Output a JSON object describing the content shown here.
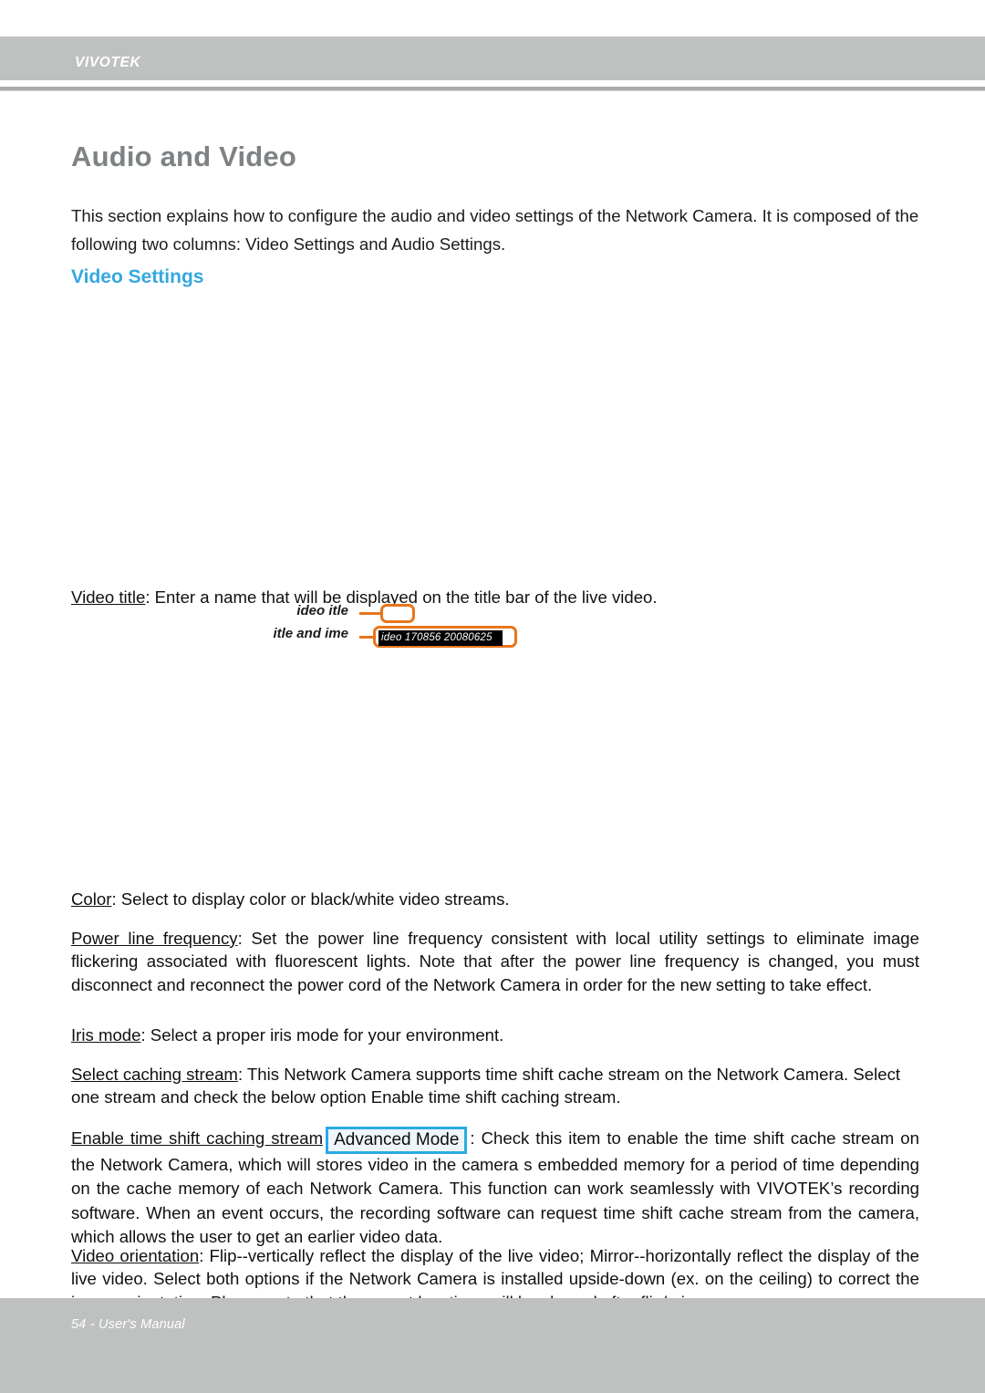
{
  "header": {
    "brand": "VIVOTEK"
  },
  "page": {
    "title": "Audio and Video",
    "intro": "This section explains how to configure the audio and video settings of the Network Camera. It is composed of the following two columns: Video Settings and Audio Settings.",
    "section_heading": "Video Settings"
  },
  "colors": {
    "header_band": "#bfc1c1",
    "heading_blue": "#35a8e0",
    "title_gray": "#7e8284",
    "callout_orange": "#e8751a",
    "badge_border": "#29abe2",
    "badge_fill": "#eef5fa"
  },
  "sections": {
    "video_title": {
      "term": "Video title",
      "body": ": Enter a name that will be displayed on the title bar of the live video."
    },
    "color": {
      "term": "Color",
      "body": ": Select to display color or black/white video streams."
    },
    "power_line_frequency": {
      "term": "Power line frequency",
      "body": ": Set the power line frequency consistent with local utility settings to eliminate image flickering associated with fluorescent lights. Note that after the power line frequency is changed, you must disconnect and reconnect the power cord of the Network Camera in order for the new setting to take effect."
    },
    "iris_mode": {
      "term": "Iris mode",
      "body": ": Select a proper iris mode for your environment."
    },
    "select_caching_stream": {
      "term": "Select caching stream",
      "body": ": This Network Camera supports time shift cache stream on the Network Camera. Select one stream and check the below option Enable time shift caching stream."
    },
    "enable_time_shift": {
      "term": "Enable time shift caching stream",
      "badge": "Advanced Mode",
      "body": ": Check this item to enable the time shift cache stream on the Network Camera, which will stores video in the camera s embedded memory for a period of time depending on the cache memory of each Network Camera. This function can work seamlessly with VIVOTEK’s recording software. When an event occurs, the recording software can request time shift cache stream from the camera, which allows the user to get an earlier video data."
    },
    "video_orientation": {
      "term": "Video orientation",
      "body": ": Flip--vertically reflect the display of the live video; Mirror--horizontally reflect the display of the live video. Select both options if the Network Camera is installed upside-down (ex. on the ceiling) to correct the image orientation.  Please note that the preset locations will be cleared after flip/mirror."
    }
  },
  "inset": {
    "label_1": "ideo itle",
    "label_2": "itle and ime",
    "osd_text": "ideo 170856  20080625"
  },
  "footer": {
    "text": "54 - User's Manual"
  }
}
